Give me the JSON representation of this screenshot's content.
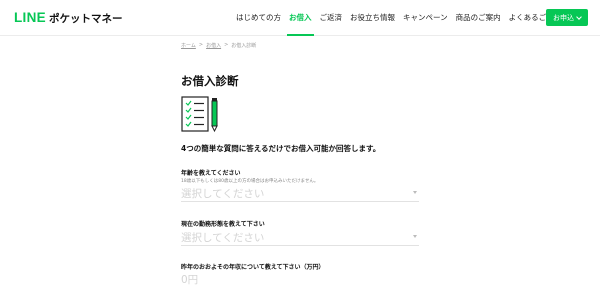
{
  "header": {
    "logo_line": "LINE",
    "logo_rest": "ポケットマネー",
    "nav": [
      {
        "label": "はじめての方"
      },
      {
        "label": "お借入"
      },
      {
        "label": "ご返済"
      },
      {
        "label": "お役立ち情報"
      },
      {
        "label": "キャンペーン"
      },
      {
        "label": "商品のご案内"
      },
      {
        "label": "よくあるご質問"
      }
    ],
    "active_nav": "お借入",
    "apply_label": "お申込",
    "accent_color": "#06c755"
  },
  "breadcrumb": {
    "items": [
      "ホーム",
      "お借入",
      "お借入診断"
    ],
    "separator": ">"
  },
  "main": {
    "title": "お借入診断",
    "lead": "4つの簡単な質問に答えるだけでお借入可能か回答します。",
    "questions": [
      {
        "label": "年齢を教えてください",
        "note": "18歳以下もしくは80歳以上の方の場合はお申込みいただけません。",
        "placeholder": "選択してください"
      },
      {
        "label": "現在の勤務形態を教えて下さい",
        "placeholder": "選択してください"
      },
      {
        "label": "昨年のおおよその年収について教えて下さい（万円）",
        "placeholder": "0円"
      }
    ]
  }
}
